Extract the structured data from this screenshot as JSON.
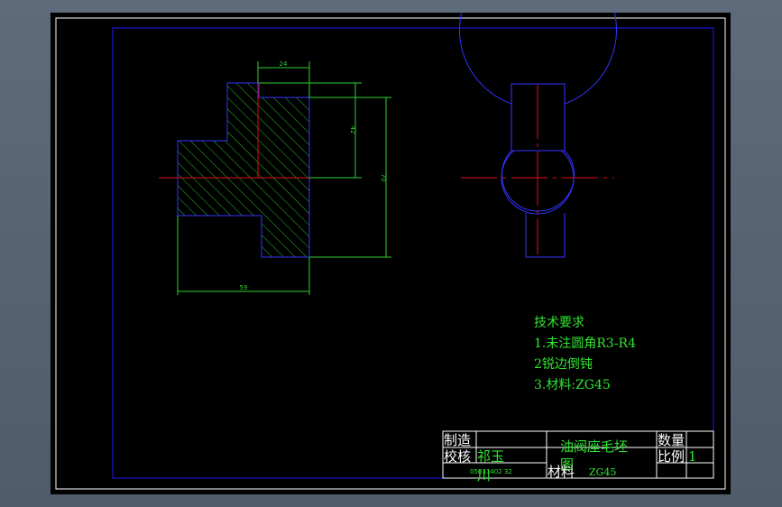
{
  "colors": {
    "border": "#ffffff",
    "frame": "#1a1aff",
    "outline": "#3333ff",
    "centerline": "#e01010",
    "hatch": "#20c020",
    "dimension": "#2fd02f",
    "note": "#2fe52f",
    "titleblock_text": "#ffffff",
    "titleblock_green": "#2fe52f"
  },
  "dimensions": {
    "top_width": "24",
    "height_upper": "42",
    "height_total": "70",
    "bottom_width": "59"
  },
  "notes": {
    "title": "技术要求",
    "line1": "1.未注圆角R3-R4",
    "line2": "2锐边倒钝",
    "line3": "3.材料:ZG45"
  },
  "title_block": {
    "made_by_label": "制造",
    "checked_label": "校核",
    "checker_name": "祁玉",
    "checker_name2": "川",
    "drawing_number": "05031402 32",
    "drawing_title": "油阀座毛坯",
    "drawing_title2": "图",
    "material_label": "材料",
    "material_value": "ZG45",
    "quantity_label": "数量",
    "scale_label": "比例",
    "scale_value": "1"
  }
}
